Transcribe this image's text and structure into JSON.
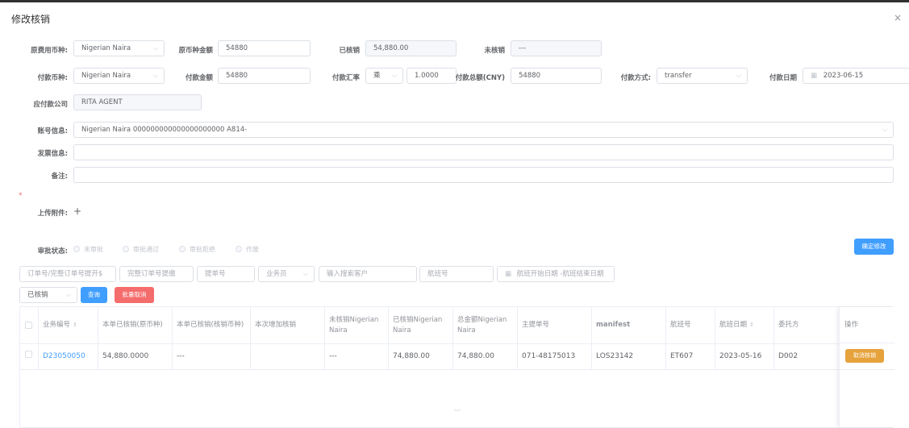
{
  "dialog": {
    "title": "修改核销",
    "close_glyph": "×"
  },
  "row1": {
    "currency_label": "原费用币种:",
    "currency_value": "Nigerian Naira",
    "amount_label": "原币种金额",
    "amount_value": "54880",
    "settled_label": "已核销",
    "settled_value": "54,880.00",
    "unsettled_label": "未核销",
    "unsettled_value": "---"
  },
  "row2": {
    "pay_currency_label": "付款币种:",
    "pay_currency_value": "Nigerian Naira",
    "pay_amount_label": "付款金额",
    "pay_amount_value": "54880",
    "rate_label": "付款汇率",
    "rate_op": "乘",
    "rate_value": "1.0000",
    "total_cny_label": "付款总额(CNY)",
    "total_cny_value": "54880",
    "method_label": "付款方式:",
    "method_value": "transfer",
    "date_label": "付款日期",
    "date_value": "2023-06-15"
  },
  "company": {
    "label": "应付款公司",
    "value": "RITA AGENT"
  },
  "account": {
    "label": "账号信息:",
    "value": "Nigerian Naira 000000000000000000000 A814-"
  },
  "invoice": {
    "label": "发票信息:",
    "value": ""
  },
  "remark": {
    "label": "备注:",
    "value": ""
  },
  "required_mark": "*",
  "upload": {
    "label": "上传附件:",
    "plus": "+"
  },
  "approval": {
    "label": "审批状态:",
    "options": [
      "未审批",
      "审批通过",
      "审批拒绝",
      "作废"
    ]
  },
  "confirm_button": "确定修改",
  "filters": {
    "order_placeholder": "订单号/完整订单号提开$",
    "full_order_placeholder": "完整订单号提缴",
    "bill_placeholder": "提单号",
    "salesman_placeholder": "业务员",
    "customer_placeholder": "输入搜索客户",
    "flight_placeholder": "航班号",
    "flight_date_placeholder": "航班开始日期 -航班结束日期",
    "status_value": "已核销",
    "search_button": "查询",
    "batch_cancel_button": "批量取消"
  },
  "table": {
    "headers": [
      "业务编号",
      "本单已核销(原币种)",
      "本单已核销(核销币种)",
      "本次增加核销",
      "未核销Nigerian Naira",
      "已核销Nigerian Naira",
      "总金额Nigerian Naira",
      "主提单号",
      "manifest",
      "航班号",
      "航班日期",
      "委托方",
      "操作"
    ],
    "rows": [
      {
        "biz_no": "D23050050",
        "settled_orig": "54,880.0000",
        "settled_pay": "---",
        "added": "",
        "unsettled": "---",
        "settled": "74,880.00",
        "total": "74,880.00",
        "mawb": "071-48175013",
        "manifest": "LOS23142",
        "flight": "ET607",
        "flight_date": "2023-05-16",
        "client": "D002",
        "action": "取消核销"
      }
    ]
  },
  "colors": {
    "primary": "#409eff",
    "danger": "#f56c6c",
    "warning": "#e6a23c"
  }
}
